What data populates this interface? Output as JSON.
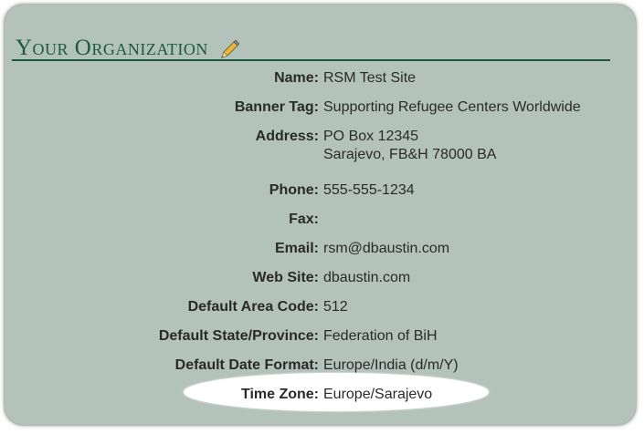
{
  "panel": {
    "title": "Your Organization",
    "edit_icon": "pencil-icon"
  },
  "fields": {
    "name": {
      "label": "Name:",
      "value": "RSM Test Site"
    },
    "banner_tag": {
      "label": "Banner Tag:",
      "value": "Supporting Refugee Centers Worldwide"
    },
    "address": {
      "label": "Address:",
      "line1": "PO Box 12345",
      "line2": "Sarajevo, FB&H 78000 BA"
    },
    "phone": {
      "label": "Phone:",
      "value": "555-555-1234"
    },
    "fax": {
      "label": "Fax:",
      "value": ""
    },
    "email": {
      "label": "Email:",
      "value": "rsm@dbaustin.com"
    },
    "web_site": {
      "label": "Web Site:",
      "value": "dbaustin.com"
    },
    "default_area_code": {
      "label": "Default Area Code:",
      "value": "512"
    },
    "default_state_province": {
      "label": "Default State/Province:",
      "value": "Federation of BiH"
    },
    "default_date_format": {
      "label": "Default Date Format:",
      "value": "Europe/India (d/m/Y)"
    },
    "time_zone": {
      "label": "Time Zone:",
      "value": "Europe/Sarajevo"
    }
  },
  "colors": {
    "panel_bg": "#b4c2bc",
    "title": "#1d5a3b",
    "rule": "#1c5a3a",
    "highlight": "#ffffff"
  }
}
